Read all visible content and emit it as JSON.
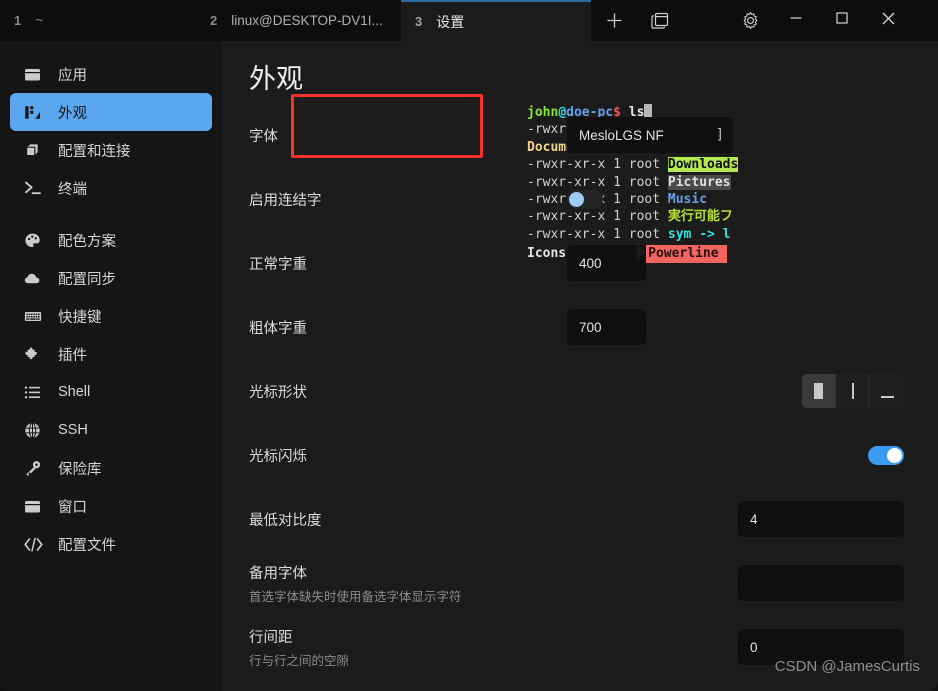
{
  "window": {
    "background": "#1b1b1b",
    "accent": "#5ba7ef",
    "annotation_color": "#f8312f"
  },
  "titlebar": {
    "tabs": [
      {
        "number": "1",
        "label": "~",
        "active": false
      },
      {
        "number": "2",
        "label": "linux@DESKTOP-DV1I...",
        "active": false
      },
      {
        "number": "3",
        "label": "设置",
        "active": true
      }
    ],
    "buttons": [
      {
        "name": "new-tab-button",
        "icon": "plus-icon"
      },
      {
        "name": "split-pane-button",
        "icon": "split-pane-icon"
      },
      {
        "name": "settings-button",
        "icon": "gear-icon"
      }
    ],
    "window_controls": [
      {
        "name": "minimize-button",
        "icon": "minimize-icon"
      },
      {
        "name": "maximize-button",
        "icon": "maximize-icon"
      },
      {
        "name": "close-button",
        "icon": "close-icon"
      }
    ]
  },
  "sidebar": {
    "items": [
      {
        "label": "应用",
        "icon": "app-window-icon",
        "active": false
      },
      {
        "label": "外观",
        "icon": "appearance-icon",
        "active": true
      },
      {
        "label": "配置和连接",
        "icon": "profiles-icon",
        "active": false
      },
      {
        "label": "终端",
        "icon": "terminal-icon",
        "active": false
      },
      {
        "label": "配色方案",
        "icon": "palette-icon",
        "active": false
      },
      {
        "label": "配置同步",
        "icon": "cloud-icon",
        "active": false
      },
      {
        "label": "快捷键",
        "icon": "keyboard-icon",
        "active": false
      },
      {
        "label": "插件",
        "icon": "puzzle-icon",
        "active": false
      },
      {
        "label": "Shell",
        "icon": "list-icon",
        "active": false
      },
      {
        "label": "SSH",
        "icon": "globe-icon",
        "active": false
      },
      {
        "label": "保险库",
        "icon": "key-icon",
        "active": false
      },
      {
        "label": "窗口",
        "icon": "window-icon",
        "active": false
      },
      {
        "label": "配置文件",
        "icon": "code-icon",
        "active": false
      }
    ]
  },
  "main": {
    "title": "外观",
    "settings": [
      {
        "label": "字体",
        "sublabel": "",
        "control": "font-input",
        "value": "MesloLGS NF",
        "caret": "]"
      },
      {
        "label": "启用连结字",
        "sublabel": "",
        "control": "toggle",
        "value": "off"
      },
      {
        "label": "正常字重",
        "sublabel": "",
        "control": "number-input",
        "value": "400"
      },
      {
        "label": "粗体字重",
        "sublabel": "",
        "control": "number-input",
        "value": "700"
      },
      {
        "label": "光标形状",
        "sublabel": "",
        "control": "segmented",
        "options": [
          "block",
          "bar",
          "underline"
        ],
        "selected": "block"
      },
      {
        "label": "光标闪烁",
        "sublabel": "",
        "control": "toggle",
        "value": "on"
      },
      {
        "label": "最低对比度",
        "sublabel": "",
        "control": "number-input",
        "value": "4"
      },
      {
        "label": "备用字体",
        "sublabel": "首选字体缺失时使用备选字体显示字符",
        "control": "text-input",
        "value": "",
        "placeholder": ""
      },
      {
        "label": "行间距",
        "sublabel": "行与行之间的空隙",
        "control": "number-input",
        "value": "0"
      }
    ]
  },
  "preview": {
    "prompt": {
      "user": "john",
      "at": "@",
      "host": "doe-pc",
      "sigil": "$",
      "command": " ls"
    },
    "lines": [
      {
        "perm": "-rwxr-xr-x 1 root",
        "name": ""
      },
      {
        "perm": "",
        "name": "Documents",
        "style": "yellow"
      },
      {
        "perm": "-rwxr-xr-x 1 root",
        "name": "Downloads",
        "style": "hl-green"
      },
      {
        "perm": "-rwxr-xr-x 1 root",
        "name": "Pictures",
        "style": "hl-grey"
      },
      {
        "perm": "-rwxr-xr-x 1 root",
        "name": "Music",
        "style": "blue"
      },
      {
        "perm": "-rwxr-xr-x 1 root",
        "name": "実行可能フ",
        "style": "lime"
      },
      {
        "perm": "-rwxr-xr-x 1 root",
        "name": "sym -> l",
        "style": "cyan-red"
      }
    ],
    "icons_label": "Icons:",
    "icons_glyphs": "\u0001\u0002\u0003",
    "powerline_label": "Powerline"
  },
  "watermark": "CSDN @JamesCurtis"
}
